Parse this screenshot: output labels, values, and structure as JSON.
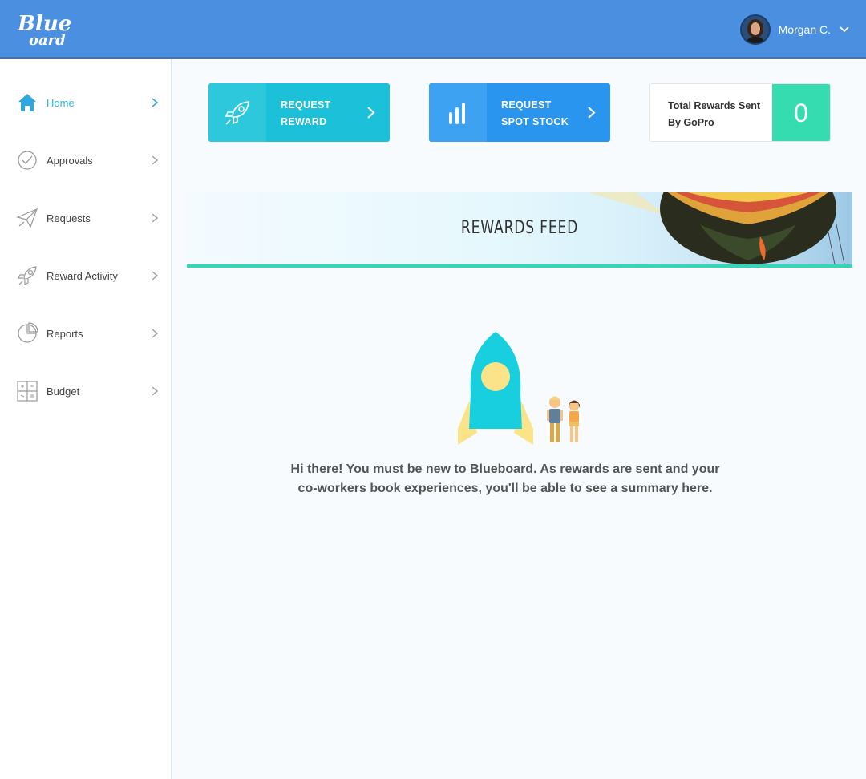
{
  "header": {
    "logo_text": "Blueboard",
    "user_name": "Morgan C."
  },
  "sidebar": {
    "items": [
      {
        "label": "Home",
        "icon": "home-icon",
        "active": true
      },
      {
        "label": "Approvals",
        "icon": "check-circle-icon",
        "active": false
      },
      {
        "label": "Requests",
        "icon": "paper-plane-icon",
        "active": false
      },
      {
        "label": "Reward Activity",
        "icon": "rocket-icon",
        "active": false
      },
      {
        "label": "Reports",
        "icon": "pie-chart-icon",
        "active": false
      },
      {
        "label": "Budget",
        "icon": "calculator-icon",
        "active": false
      }
    ]
  },
  "actions": {
    "request_reward": {
      "line1": "REQUEST",
      "line2": "REWARD",
      "icon": "rocket-icon"
    },
    "request_spot_stock": {
      "line1": "REQUEST",
      "line2": "SPOT STOCK",
      "icon": "bar-chart-icon"
    }
  },
  "stats": {
    "label_line1": "Total Rewards Sent",
    "label_line2": "By GoPro",
    "value": "0"
  },
  "feed": {
    "title": "REWARDS FEED",
    "empty_line1": "Hi there! You must be new to Blueboard. As rewards are sent and your",
    "empty_line2": "co-workers book experiences, you'll be able to see a summary here."
  },
  "colors": {
    "header": "#4a8fe0",
    "accent": "#2fb3dd",
    "reward_card": "#1cc0d9",
    "stock_card": "#2a95ee",
    "stat_value": "#35dcb0",
    "feed_line": "#35d6b8"
  }
}
